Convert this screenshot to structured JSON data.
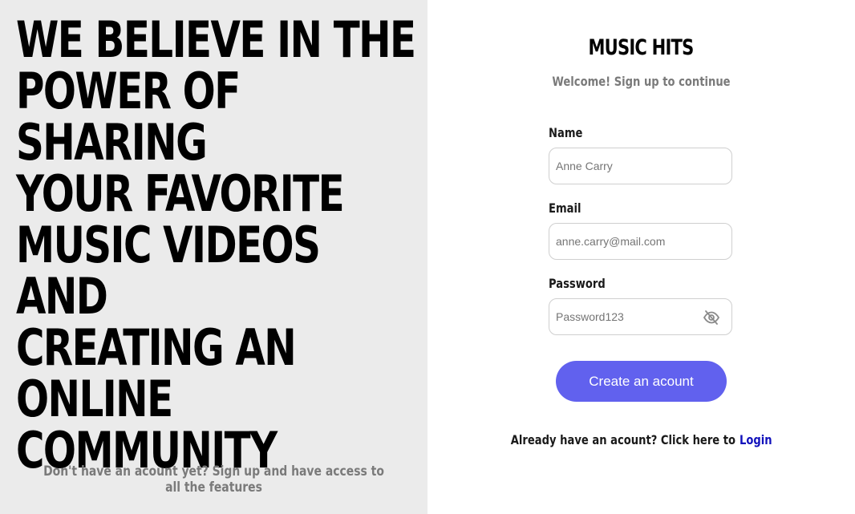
{
  "hero": {
    "lines": [
      "WE BELIEVE IN THE",
      "POWER OF SHARING",
      "YOUR FAVORITE",
      "MUSIC VIDEOS AND",
      "CREATING AN ONLINE",
      "COMMUNITY"
    ]
  },
  "left_footer": "Don't have an acount yet? Sign up and have access to all the features",
  "brand": "MUSIC HITS",
  "subtitle": "Welcome! Sign up to continue",
  "form": {
    "name_label": "Name",
    "name_placeholder": "Anne Carry",
    "email_label": "Email",
    "email_placeholder": "anne.carry@mail.com",
    "password_label": "Password",
    "password_placeholder": "Password123",
    "password_toggle_icon": "eye-off-icon",
    "submit_label": "Create an acount"
  },
  "login": {
    "prompt": "Already have an acount? Click here to",
    "link_label": "Login"
  },
  "colors": {
    "left_panel_bg": "#ebebeb",
    "accent": "#6161ee",
    "link": "#1111bb",
    "muted_text": "#7a7a7a"
  }
}
